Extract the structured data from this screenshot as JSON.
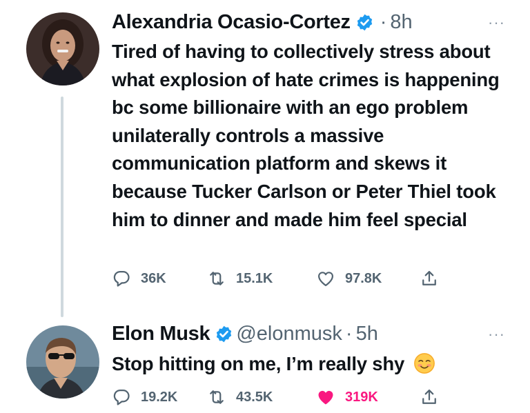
{
  "tweet1": {
    "name": "Alexandria Ocasio-Cortez",
    "dot": "·",
    "time": "8h",
    "more": "···",
    "text": "Tired of having to collectively stress about what explosion of hate crimes is happening bc some billionaire with an ego problem unilaterally controls a massive communication platform and skews it because Tucker Carlson or Peter Thiel took him to dinner and made him feel special",
    "replies": "36K",
    "retweets": "15.1K",
    "likes": "97.8K"
  },
  "tweet2": {
    "name": "Elon Musk",
    "handle": "@elonmusk",
    "dot": "·",
    "time": "5h",
    "more": "···",
    "text": "Stop hitting on me, I’m really shy",
    "emoji": "smiling-face-with-blush-emoji",
    "replies": "19.2K",
    "retweets": "43.5K",
    "likes": "319K",
    "liked": true
  },
  "colors": {
    "text": "#0f1419",
    "secondary": "#536471",
    "verified": "#1d9bf0",
    "liked": "#f91880",
    "thread_line": "#cfd9de"
  }
}
